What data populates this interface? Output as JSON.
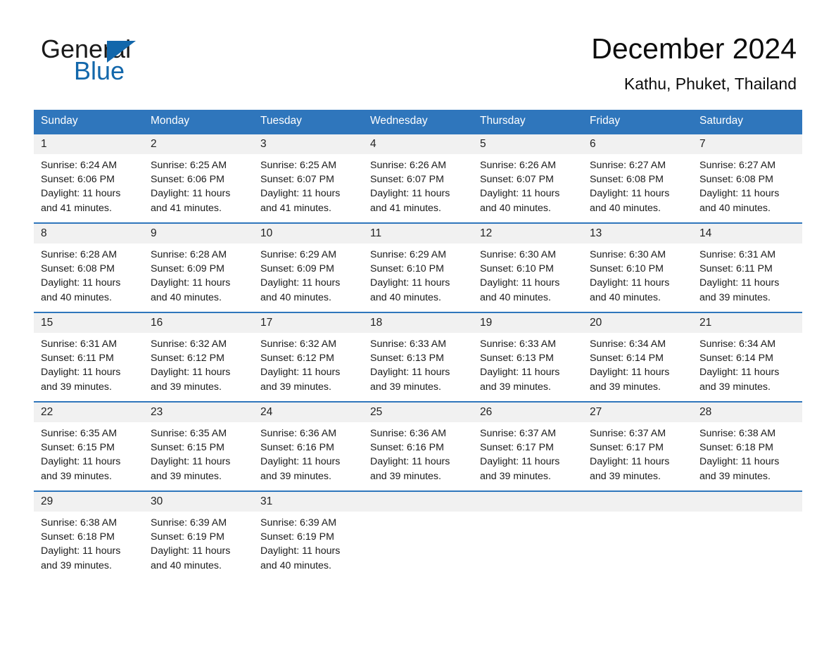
{
  "brand": {
    "line1": "General",
    "line2": "Blue",
    "accent_color": "#1267ab"
  },
  "header": {
    "title": "December 2024",
    "subtitle": "Kathu, Phuket, Thailand"
  },
  "theme": {
    "header_blue": "#2f76bc",
    "daynum_band": "#f1f1f1",
    "text": "#1a1a1a"
  },
  "calendar": {
    "weekday_headers": [
      "Sunday",
      "Monday",
      "Tuesday",
      "Wednesday",
      "Thursday",
      "Friday",
      "Saturday"
    ],
    "labels": {
      "sunrise": "Sunrise:",
      "sunset": "Sunset:",
      "daylight": "Daylight:"
    },
    "weeks": [
      [
        {
          "day": "1",
          "sunrise": "Sunrise: 6:24 AM",
          "sunset": "Sunset: 6:06 PM",
          "daylight_line1": "Daylight: 11 hours",
          "daylight_line2": "and 41 minutes."
        },
        {
          "day": "2",
          "sunrise": "Sunrise: 6:25 AM",
          "sunset": "Sunset: 6:06 PM",
          "daylight_line1": "Daylight: 11 hours",
          "daylight_line2": "and 41 minutes."
        },
        {
          "day": "3",
          "sunrise": "Sunrise: 6:25 AM",
          "sunset": "Sunset: 6:07 PM",
          "daylight_line1": "Daylight: 11 hours",
          "daylight_line2": "and 41 minutes."
        },
        {
          "day": "4",
          "sunrise": "Sunrise: 6:26 AM",
          "sunset": "Sunset: 6:07 PM",
          "daylight_line1": "Daylight: 11 hours",
          "daylight_line2": "and 41 minutes."
        },
        {
          "day": "5",
          "sunrise": "Sunrise: 6:26 AM",
          "sunset": "Sunset: 6:07 PM",
          "daylight_line1": "Daylight: 11 hours",
          "daylight_line2": "and 40 minutes."
        },
        {
          "day": "6",
          "sunrise": "Sunrise: 6:27 AM",
          "sunset": "Sunset: 6:08 PM",
          "daylight_line1": "Daylight: 11 hours",
          "daylight_line2": "and 40 minutes."
        },
        {
          "day": "7",
          "sunrise": "Sunrise: 6:27 AM",
          "sunset": "Sunset: 6:08 PM",
          "daylight_line1": "Daylight: 11 hours",
          "daylight_line2": "and 40 minutes."
        }
      ],
      [
        {
          "day": "8",
          "sunrise": "Sunrise: 6:28 AM",
          "sunset": "Sunset: 6:08 PM",
          "daylight_line1": "Daylight: 11 hours",
          "daylight_line2": "and 40 minutes."
        },
        {
          "day": "9",
          "sunrise": "Sunrise: 6:28 AM",
          "sunset": "Sunset: 6:09 PM",
          "daylight_line1": "Daylight: 11 hours",
          "daylight_line2": "and 40 minutes."
        },
        {
          "day": "10",
          "sunrise": "Sunrise: 6:29 AM",
          "sunset": "Sunset: 6:09 PM",
          "daylight_line1": "Daylight: 11 hours",
          "daylight_line2": "and 40 minutes."
        },
        {
          "day": "11",
          "sunrise": "Sunrise: 6:29 AM",
          "sunset": "Sunset: 6:10 PM",
          "daylight_line1": "Daylight: 11 hours",
          "daylight_line2": "and 40 minutes."
        },
        {
          "day": "12",
          "sunrise": "Sunrise: 6:30 AM",
          "sunset": "Sunset: 6:10 PM",
          "daylight_line1": "Daylight: 11 hours",
          "daylight_line2": "and 40 minutes."
        },
        {
          "day": "13",
          "sunrise": "Sunrise: 6:30 AM",
          "sunset": "Sunset: 6:10 PM",
          "daylight_line1": "Daylight: 11 hours",
          "daylight_line2": "and 40 minutes."
        },
        {
          "day": "14",
          "sunrise": "Sunrise: 6:31 AM",
          "sunset": "Sunset: 6:11 PM",
          "daylight_line1": "Daylight: 11 hours",
          "daylight_line2": "and 39 minutes."
        }
      ],
      [
        {
          "day": "15",
          "sunrise": "Sunrise: 6:31 AM",
          "sunset": "Sunset: 6:11 PM",
          "daylight_line1": "Daylight: 11 hours",
          "daylight_line2": "and 39 minutes."
        },
        {
          "day": "16",
          "sunrise": "Sunrise: 6:32 AM",
          "sunset": "Sunset: 6:12 PM",
          "daylight_line1": "Daylight: 11 hours",
          "daylight_line2": "and 39 minutes."
        },
        {
          "day": "17",
          "sunrise": "Sunrise: 6:32 AM",
          "sunset": "Sunset: 6:12 PM",
          "daylight_line1": "Daylight: 11 hours",
          "daylight_line2": "and 39 minutes."
        },
        {
          "day": "18",
          "sunrise": "Sunrise: 6:33 AM",
          "sunset": "Sunset: 6:13 PM",
          "daylight_line1": "Daylight: 11 hours",
          "daylight_line2": "and 39 minutes."
        },
        {
          "day": "19",
          "sunrise": "Sunrise: 6:33 AM",
          "sunset": "Sunset: 6:13 PM",
          "daylight_line1": "Daylight: 11 hours",
          "daylight_line2": "and 39 minutes."
        },
        {
          "day": "20",
          "sunrise": "Sunrise: 6:34 AM",
          "sunset": "Sunset: 6:14 PM",
          "daylight_line1": "Daylight: 11 hours",
          "daylight_line2": "and 39 minutes."
        },
        {
          "day": "21",
          "sunrise": "Sunrise: 6:34 AM",
          "sunset": "Sunset: 6:14 PM",
          "daylight_line1": "Daylight: 11 hours",
          "daylight_line2": "and 39 minutes."
        }
      ],
      [
        {
          "day": "22",
          "sunrise": "Sunrise: 6:35 AM",
          "sunset": "Sunset: 6:15 PM",
          "daylight_line1": "Daylight: 11 hours",
          "daylight_line2": "and 39 minutes."
        },
        {
          "day": "23",
          "sunrise": "Sunrise: 6:35 AM",
          "sunset": "Sunset: 6:15 PM",
          "daylight_line1": "Daylight: 11 hours",
          "daylight_line2": "and 39 minutes."
        },
        {
          "day": "24",
          "sunrise": "Sunrise: 6:36 AM",
          "sunset": "Sunset: 6:16 PM",
          "daylight_line1": "Daylight: 11 hours",
          "daylight_line2": "and 39 minutes."
        },
        {
          "day": "25",
          "sunrise": "Sunrise: 6:36 AM",
          "sunset": "Sunset: 6:16 PM",
          "daylight_line1": "Daylight: 11 hours",
          "daylight_line2": "and 39 minutes."
        },
        {
          "day": "26",
          "sunrise": "Sunrise: 6:37 AM",
          "sunset": "Sunset: 6:17 PM",
          "daylight_line1": "Daylight: 11 hours",
          "daylight_line2": "and 39 minutes."
        },
        {
          "day": "27",
          "sunrise": "Sunrise: 6:37 AM",
          "sunset": "Sunset: 6:17 PM",
          "daylight_line1": "Daylight: 11 hours",
          "daylight_line2": "and 39 minutes."
        },
        {
          "day": "28",
          "sunrise": "Sunrise: 6:38 AM",
          "sunset": "Sunset: 6:18 PM",
          "daylight_line1": "Daylight: 11 hours",
          "daylight_line2": "and 39 minutes."
        }
      ],
      [
        {
          "day": "29",
          "sunrise": "Sunrise: 6:38 AM",
          "sunset": "Sunset: 6:18 PM",
          "daylight_line1": "Daylight: 11 hours",
          "daylight_line2": "and 39 minutes."
        },
        {
          "day": "30",
          "sunrise": "Sunrise: 6:39 AM",
          "sunset": "Sunset: 6:19 PM",
          "daylight_line1": "Daylight: 11 hours",
          "daylight_line2": "and 40 minutes."
        },
        {
          "day": "31",
          "sunrise": "Sunrise: 6:39 AM",
          "sunset": "Sunset: 6:19 PM",
          "daylight_line1": "Daylight: 11 hours",
          "daylight_line2": "and 40 minutes."
        },
        {
          "day": "",
          "sunrise": "",
          "sunset": "",
          "daylight_line1": "",
          "daylight_line2": ""
        },
        {
          "day": "",
          "sunrise": "",
          "sunset": "",
          "daylight_line1": "",
          "daylight_line2": ""
        },
        {
          "day": "",
          "sunrise": "",
          "sunset": "",
          "daylight_line1": "",
          "daylight_line2": ""
        },
        {
          "day": "",
          "sunrise": "",
          "sunset": "",
          "daylight_line1": "",
          "daylight_line2": ""
        }
      ]
    ]
  }
}
